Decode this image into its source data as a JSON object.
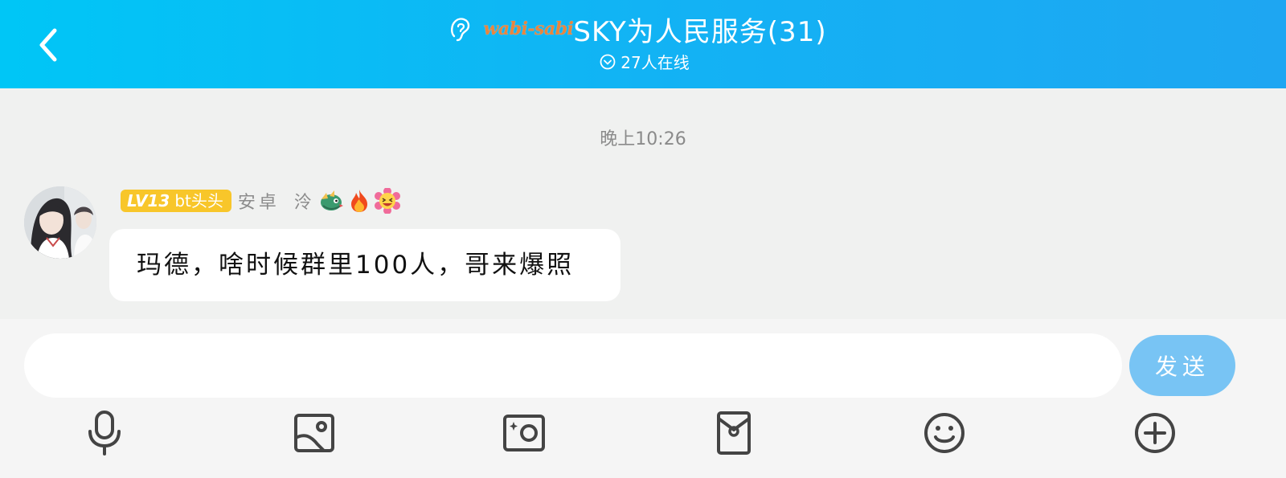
{
  "header": {
    "brand_logo_text": "wabi-sabi",
    "group_name": "SKY为人民服务(31)",
    "online_status": "27人在线",
    "icons": {
      "back": "chevron-left-icon",
      "ear": "ear-icon",
      "online": "chevron-down-circle-icon"
    }
  },
  "chat": {
    "timestamp": "晚上10:26",
    "messages": [
      {
        "level": "LV13",
        "title": "bt头头",
        "device": "安卓",
        "nickname": "泠",
        "emojis": [
          "dragon-emoji",
          "fire-emoji",
          "laughing-flower-emoji"
        ],
        "text": "玛德，啥时候群里100人，哥来爆照"
      }
    ]
  },
  "composer": {
    "placeholder": "",
    "value": "",
    "send_label": "发送"
  },
  "toolbar": {
    "items": [
      "microphone-icon",
      "image-icon",
      "camera-icon",
      "red-packet-icon",
      "smiley-icon",
      "plus-circle-icon"
    ]
  },
  "colors": {
    "header_start": "#00c6f6",
    "header_end": "#1ea6f2",
    "badge": "#f8c62a",
    "send_button": "#78c4f4",
    "background": "#f0f1f0"
  }
}
